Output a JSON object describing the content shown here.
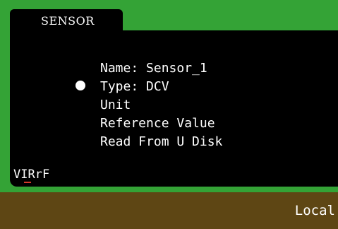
{
  "tab": {
    "label": "SENSOR"
  },
  "menu": {
    "selected_index": 1,
    "items": [
      {
        "label": "Name: Sensor_1"
      },
      {
        "label": "Type: DCV"
      },
      {
        "label": "Unit"
      },
      {
        "label": "Reference Value"
      },
      {
        "label": "Read From U Disk"
      }
    ]
  },
  "brand": {
    "label": "VIRrF"
  },
  "status_bar": {
    "mode": "Local"
  },
  "colors": {
    "frame_green": "#34a336",
    "panel_black": "#000000",
    "status_brown": "#5e4614",
    "text_white": "#ffffff",
    "brand_underline_red": "#d43a2a"
  },
  "icons": {
    "selection_marker": "filled-circle-icon"
  }
}
